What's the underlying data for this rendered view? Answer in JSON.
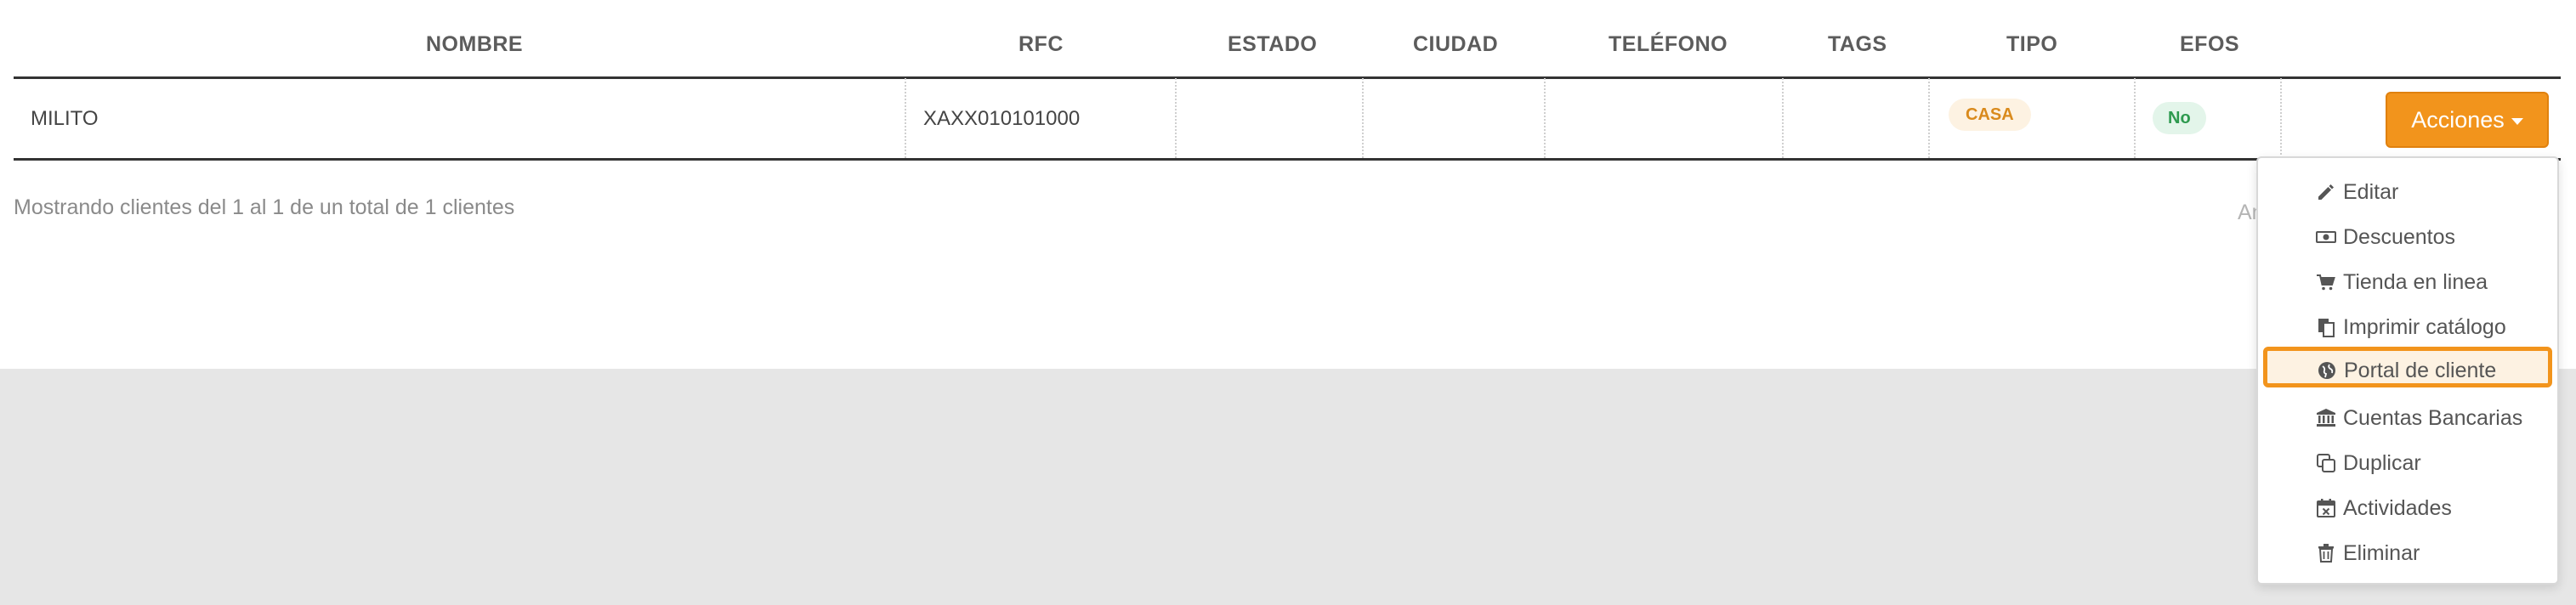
{
  "table": {
    "headers": [
      "NOMBRE",
      "RFC",
      "ESTADO",
      "CIUDAD",
      "TELÉFONO",
      "TAGS",
      "TIPO",
      "EFOS"
    ],
    "rows": [
      {
        "nombre": "MILITO",
        "rfc": "XAXX010101000",
        "estado": "",
        "ciudad": "",
        "telefono": "",
        "tags": "",
        "tipo": "CASA",
        "efos": "No"
      }
    ],
    "actions_label": "Acciones"
  },
  "footer": {
    "summary": "Mostrando clientes del 1 al 1 de un total de 1 clientes",
    "pagination_partial": "An"
  },
  "menu": {
    "items": [
      {
        "label": "Editar",
        "icon": "pencil-icon"
      },
      {
        "label": "Descuentos",
        "icon": "money-icon"
      },
      {
        "label": "Tienda en linea",
        "icon": "cart-icon"
      },
      {
        "label": "Imprimir catálogo",
        "icon": "copy-document-icon"
      },
      {
        "label": "Portal de cliente",
        "icon": "globe-icon",
        "highlighted": true
      },
      {
        "label": "Cuentas Bancarias",
        "icon": "bank-icon"
      },
      {
        "label": "Duplicar",
        "icon": "duplicate-icon"
      },
      {
        "label": "Actividades",
        "icon": "calendar-icon"
      },
      {
        "label": "Eliminar",
        "icon": "trash-icon"
      }
    ]
  },
  "colors": {
    "accent": "#f2941c",
    "badge_casa_bg": "#fdf2e2",
    "badge_casa_text": "#d98a1c",
    "badge_no_bg": "#e3f5ea",
    "badge_no_text": "#2e9a4f",
    "page_background": "#e6e6e6"
  }
}
